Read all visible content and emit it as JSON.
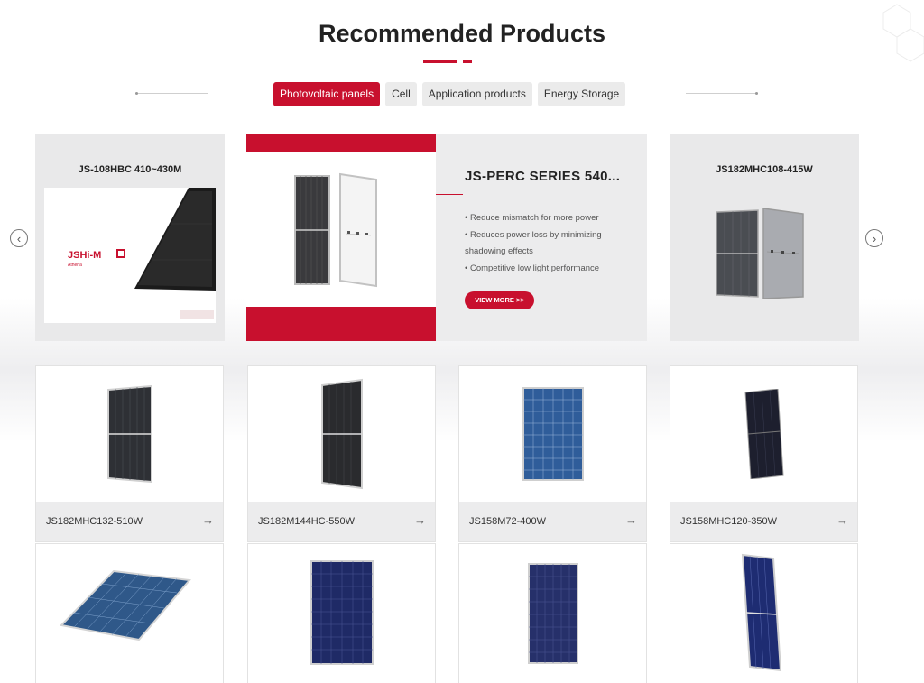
{
  "section": {
    "title": "Recommended Products"
  },
  "tabs": [
    {
      "label": "Photovoltaic panels",
      "active": true
    },
    {
      "label": "Cell",
      "active": false
    },
    {
      "label": "Application products",
      "active": false
    },
    {
      "label": "Energy Storage",
      "active": false
    }
  ],
  "carousel": {
    "prev_icon": "chevron-left-icon",
    "next_icon": "chevron-right-icon",
    "left": {
      "name": "JS-108HBC 410~430M",
      "brand": "JSHi-M",
      "sub": "Athena"
    },
    "featured": {
      "name": "JS-PERC SERIES 540...",
      "bullets": [
        "Reduce mismatch for more power",
        "Reduces power loss by minimizing shadowing effects",
        "Competitive low light performance"
      ],
      "button": "VIEW MORE >>"
    },
    "right": {
      "name": "JS182MHC108-415W"
    }
  },
  "products": [
    {
      "name": "JS182MHC132-510W",
      "arrow": "→"
    },
    {
      "name": "JS182M144HC-550W",
      "arrow": "→"
    },
    {
      "name": "JS158M72-400W",
      "arrow": "→"
    },
    {
      "name": "JS158MHC120-350W",
      "arrow": "→"
    }
  ],
  "colors": {
    "accent": "#c8102e",
    "panel_bg": "#ececed"
  }
}
